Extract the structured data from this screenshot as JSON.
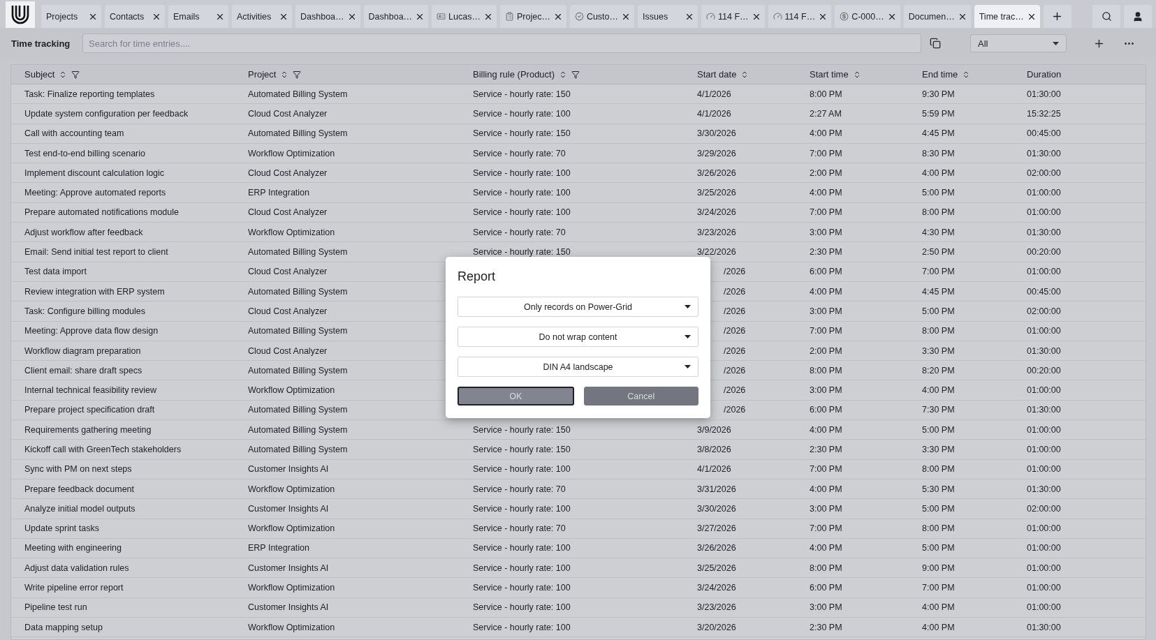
{
  "tabs": [
    {
      "label": "Projects",
      "kind": "plain",
      "selected": false
    },
    {
      "label": "Contacts",
      "kind": "plain",
      "selected": false
    },
    {
      "label": "Emails",
      "kind": "plain",
      "selected": false
    },
    {
      "label": "Activities",
      "kind": "plain",
      "selected": false
    },
    {
      "label": "Dashboa…",
      "kind": "plain",
      "selected": false
    },
    {
      "label": "Dashboa…",
      "kind": "plain",
      "selected": false
    },
    {
      "label": "Lucas…",
      "kind": "contact",
      "selected": false
    },
    {
      "label": "Projec…",
      "kind": "project",
      "selected": false
    },
    {
      "label": "Custo…",
      "kind": "customer",
      "selected": false
    },
    {
      "label": "Issues",
      "kind": "plain",
      "selected": false
    },
    {
      "label": "114 F…",
      "kind": "meter",
      "selected": false
    },
    {
      "label": "114 F…",
      "kind": "meter",
      "selected": false
    },
    {
      "label": "C-000…",
      "kind": "payment",
      "selected": false
    },
    {
      "label": "Documen…",
      "kind": "plain",
      "selected": false
    },
    {
      "label": "Time trac…",
      "kind": "plain",
      "selected": true
    }
  ],
  "toolbar": {
    "title": "Time tracking",
    "search": {
      "placeholder": "Search for time entries...."
    },
    "filter": "All"
  },
  "table": {
    "columns": [
      {
        "label": "Subject",
        "sortable": true,
        "filterable": true
      },
      {
        "label": "Project",
        "sortable": true,
        "filterable": true
      },
      {
        "label": "Billing rule (Product)",
        "sortable": true,
        "filterable": true
      },
      {
        "label": "Start date",
        "sortable": true,
        "filterable": false
      },
      {
        "label": "Start time",
        "sortable": true,
        "filterable": false
      },
      {
        "label": "End time",
        "sortable": true,
        "filterable": false
      },
      {
        "label": "Duration",
        "sortable": false,
        "filterable": false
      }
    ],
    "rows": [
      {
        "cells": [
          "Task: Finalize reporting templates",
          "Automated Billing System",
          "Service - hourly rate: 150",
          "4/1/2026",
          "8:00 PM",
          "9:30 PM",
          "01:30:00"
        ]
      },
      {
        "cells": [
          "Update system configuration per feedback",
          "Cloud Cost Analyzer",
          "Service - hourly rate: 100",
          "4/1/2026",
          "2:27 AM",
          "5:59 PM",
          "15:32:25"
        ]
      },
      {
        "cells": [
          "Call with accounting team",
          "Automated Billing System",
          "Service - hourly rate: 150",
          "3/30/2026",
          "4:00 PM",
          "4:45 PM",
          "00:45:00"
        ]
      },
      {
        "cells": [
          "Test end-to-end billing scenario",
          "Workflow Optimization",
          "Service - hourly rate: 70",
          "3/29/2026",
          "7:00 PM",
          "8:30 PM",
          "01:30:00"
        ]
      },
      {
        "cells": [
          "Implement discount calculation logic",
          "Cloud Cost Analyzer",
          "Service - hourly rate: 100",
          "3/26/2026",
          "2:00 PM",
          "4:00 PM",
          "02:00:00"
        ]
      },
      {
        "cells": [
          "Meeting: Approve automated reports",
          "ERP Integration",
          "Service - hourly rate: 100",
          "3/25/2026",
          "4:00 PM",
          "5:00 PM",
          "01:00:00"
        ]
      },
      {
        "cells": [
          "Prepare automated notifications module",
          "Cloud Cost Analyzer",
          "Service - hourly rate: 100",
          "3/24/2026",
          "7:00 PM",
          "8:00 PM",
          "01:00:00"
        ]
      },
      {
        "cells": [
          "Adjust workflow after feedback",
          "Workflow Optimization",
          "Service - hourly rate: 70",
          "3/23/2026",
          "3:00 PM",
          "4:30 PM",
          "01:30:00"
        ]
      },
      {
        "cells": [
          "Email: Send initial test report to client",
          "Automated Billing System",
          "Service - hourly rate: 150",
          "3/22/2026",
          "2:30 PM",
          "2:50 PM",
          "00:20:00"
        ]
      },
      {
        "cells": [
          "Test data import",
          "Cloud Cost Analyzer",
          null,
          "/2026",
          "6:00 PM",
          "7:00 PM",
          "01:00:00"
        ]
      },
      {
        "cells": [
          "Review integration with ERP system",
          "Automated Billing System",
          null,
          "/2026",
          "4:00 PM",
          "4:45 PM",
          "00:45:00"
        ]
      },
      {
        "cells": [
          "Task: Configure billing modules",
          "Cloud Cost Analyzer",
          null,
          "/2026",
          "3:00 PM",
          "5:00 PM",
          "02:00:00"
        ]
      },
      {
        "cells": [
          "Meeting: Approve data flow design",
          "Automated Billing System",
          null,
          "/2026",
          "7:00 PM",
          "8:00 PM",
          "01:00:00"
        ]
      },
      {
        "cells": [
          "Workflow diagram preparation",
          "Cloud Cost Analyzer",
          null,
          "/2026",
          "2:00 PM",
          "3:30 PM",
          "01:30:00"
        ]
      },
      {
        "cells": [
          "Client email: share draft specs",
          "Automated Billing System",
          null,
          "/2026",
          "8:00 PM",
          "8:20 PM",
          "00:20:00"
        ]
      },
      {
        "cells": [
          "Internal technical feasibility review",
          "Workflow Optimization",
          null,
          "/2026",
          "3:00 PM",
          "4:00 PM",
          "01:00:00"
        ]
      },
      {
        "cells": [
          "Prepare project specification draft",
          "Automated Billing System",
          null,
          "/2026",
          "6:00 PM",
          "7:30 PM",
          "01:30:00"
        ]
      },
      {
        "cells": [
          "Requirements gathering meeting",
          "Automated Billing System",
          "Service - hourly rate: 150",
          "3/9/2026",
          "4:00 PM",
          "5:00 PM",
          "01:00:00"
        ]
      },
      {
        "cells": [
          "Kickoff call with GreenTech stakeholders",
          "Automated Billing System",
          "Service - hourly rate: 150",
          "3/8/2026",
          "2:30 PM",
          "3:30 PM",
          "01:00:00"
        ]
      },
      {
        "cells": [
          "Sync with PM on next steps",
          "Customer Insights AI",
          "Service - hourly rate: 100",
          "4/1/2026",
          "7:00 PM",
          "8:00 PM",
          "01:00:00"
        ]
      },
      {
        "cells": [
          "Prepare feedback document",
          "Workflow Optimization",
          "Service - hourly rate: 70",
          "3/31/2026",
          "4:00 PM",
          "5:30 PM",
          "01:30:00"
        ]
      },
      {
        "cells": [
          "Analyze initial model outputs",
          "Customer Insights AI",
          "Service - hourly rate: 100",
          "3/30/2026",
          "3:00 PM",
          "5:00 PM",
          "02:00:00"
        ]
      },
      {
        "cells": [
          "Update sprint tasks",
          "Workflow Optimization",
          "Service - hourly rate: 70",
          "3/27/2026",
          "7:00 PM",
          "8:00 PM",
          "01:00:00"
        ]
      },
      {
        "cells": [
          "Meeting with engineering",
          "ERP Integration",
          "Service - hourly rate: 100",
          "3/26/2026",
          "4:00 PM",
          "5:00 PM",
          "01:00:00"
        ]
      },
      {
        "cells": [
          "Adjust data validation rules",
          "Customer Insights AI",
          "Service - hourly rate: 100",
          "3/25/2026",
          "8:00 PM",
          "9:00 PM",
          "01:00:00"
        ]
      },
      {
        "cells": [
          "Write pipeline error report",
          "Workflow Optimization",
          "Service - hourly rate: 100",
          "3/24/2026",
          "6:00 PM",
          "7:00 PM",
          "01:00:00"
        ]
      },
      {
        "cells": [
          "Pipeline test run",
          "Customer Insights AI",
          "Service - hourly rate: 100",
          "3/23/2026",
          "3:00 PM",
          "4:00 PM",
          "01:00:00"
        ]
      },
      {
        "cells": [
          "Data mapping setup",
          "Workflow Optimization",
          "Service - hourly rate: 100",
          "3/20/2026",
          "2:30 PM",
          "4:00 PM",
          "01:30:00"
        ]
      }
    ]
  },
  "dialog": {
    "title": "Report",
    "selects": [
      "Only records on Power-Grid",
      "Do not wrap content",
      "DIN A4 landscape"
    ],
    "buttons": [
      {
        "label": "OK",
        "focused": true
      },
      {
        "label": "Cancel",
        "focused": false
      }
    ]
  }
}
